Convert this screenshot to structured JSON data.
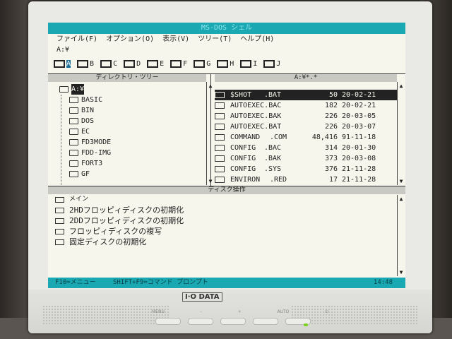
{
  "window": {
    "title": "MS-DOS シェル"
  },
  "menu": [
    {
      "label": "ファイル(F)"
    },
    {
      "label": "オプション(O)"
    },
    {
      "label": "表示(V)"
    },
    {
      "label": "ツリー(T)"
    },
    {
      "label": "ヘルプ(H)"
    }
  ],
  "path": "A:¥",
  "drives": [
    {
      "letter": "A"
    },
    {
      "letter": "B"
    },
    {
      "letter": "C"
    },
    {
      "letter": "D"
    },
    {
      "letter": "E"
    },
    {
      "letter": "F"
    },
    {
      "letter": "G"
    },
    {
      "letter": "H"
    },
    {
      "letter": "I"
    },
    {
      "letter": "J"
    }
  ],
  "dir_tree": {
    "header": "ディレクトリ・ツリー",
    "root": "A:¥",
    "items": [
      "BASIC",
      "BIN",
      "DOS",
      "EC",
      "FD3MODE",
      "FDD-IMG",
      "FORT3",
      "GF"
    ]
  },
  "file_list": {
    "header": "A:¥*.*",
    "rows": [
      {
        "name": "$SHOT",
        "ext": ".BAT",
        "size": "50",
        "date": "20-02-21"
      },
      {
        "name": "AUTOEXEC",
        "ext": ".BAC",
        "size": "182",
        "date": "20-02-21"
      },
      {
        "name": "AUTOEXEC",
        "ext": ".BAK",
        "size": "226",
        "date": "20-03-05"
      },
      {
        "name": "AUTOEXEC",
        "ext": ".BAT",
        "size": "226",
        "date": "20-03-07"
      },
      {
        "name": "COMMAND",
        "ext": ".COM",
        "size": "48,416",
        "date": "91-11-18"
      },
      {
        "name": "CONFIG",
        "ext": ".BAC",
        "size": "314",
        "date": "20-01-30"
      },
      {
        "name": "CONFIG",
        "ext": ".BAK",
        "size": "373",
        "date": "20-03-08"
      },
      {
        "name": "CONFIG",
        "ext": ".SYS",
        "size": "376",
        "date": "21-11-28"
      },
      {
        "name": "ENVIRON",
        "ext": ".RED",
        "size": "17",
        "date": "21-11-28"
      }
    ]
  },
  "disk_ops": {
    "header": "ディスク操作",
    "items": [
      "メイン",
      "2HDフロッピィディスクの初期化",
      "2DDフロッピィディスクの初期化",
      "フロッピィディスクの複写",
      "固定ディスクの初期化"
    ]
  },
  "status": {
    "f10": "F10=メニュー",
    "shift_f9": "SHIFT+F9=コマンド プロンプト",
    "time": "14:48"
  },
  "monitor": {
    "brand": "I·O DATA",
    "buttons": [
      "MENU",
      "-",
      "+",
      "AUTO",
      "⏻"
    ]
  }
}
